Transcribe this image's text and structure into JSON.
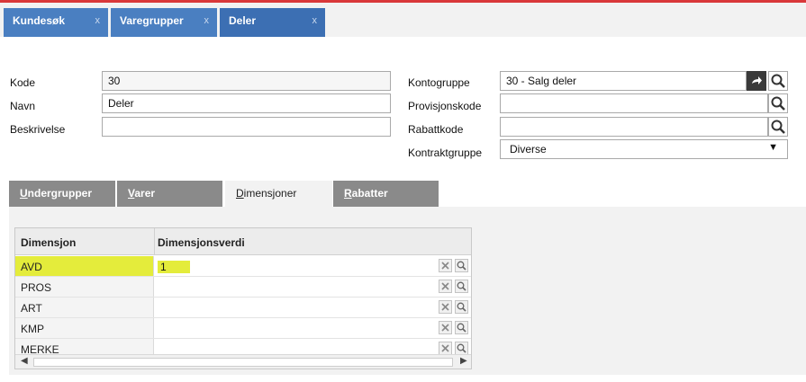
{
  "doc_tabs": [
    {
      "label": "Kundesøk",
      "close": "x"
    },
    {
      "label": "Varegrupper",
      "close": "x"
    },
    {
      "label": "Deler",
      "close": "x"
    }
  ],
  "form": {
    "kode": {
      "label": "Kode",
      "value": "30"
    },
    "navn": {
      "label": "Navn",
      "value": "Deler"
    },
    "beskrivelse": {
      "label": "Beskrivelse",
      "value": ""
    },
    "kontogruppe": {
      "label": "Kontogruppe",
      "value": "30 - Salg deler"
    },
    "provisjonskode": {
      "label": "Provisjonskode",
      "value": ""
    },
    "rabattkode": {
      "label": "Rabattkode",
      "value": ""
    },
    "kontraktgruppe": {
      "label": "Kontraktgruppe",
      "value": "Diverse"
    }
  },
  "subtabs": [
    {
      "key": "U",
      "rest": "ndergrupper"
    },
    {
      "key": "V",
      "rest": "arer"
    },
    {
      "key": "D",
      "rest": "imensjoner"
    },
    {
      "key": "R",
      "rest": "abatter"
    }
  ],
  "grid": {
    "col1": "Dimensjon",
    "col2": "Dimensjonsverdi",
    "rows": [
      {
        "dim": "AVD",
        "val": "1"
      },
      {
        "dim": "PROS",
        "val": ""
      },
      {
        "dim": "ART",
        "val": ""
      },
      {
        "dim": "KMP",
        "val": ""
      },
      {
        "dim": "MERKE",
        "val": ""
      }
    ]
  },
  "colors": {
    "accent": "#3c6fb3",
    "highlight": "#e4ec3b",
    "topline": "#d9383a"
  }
}
